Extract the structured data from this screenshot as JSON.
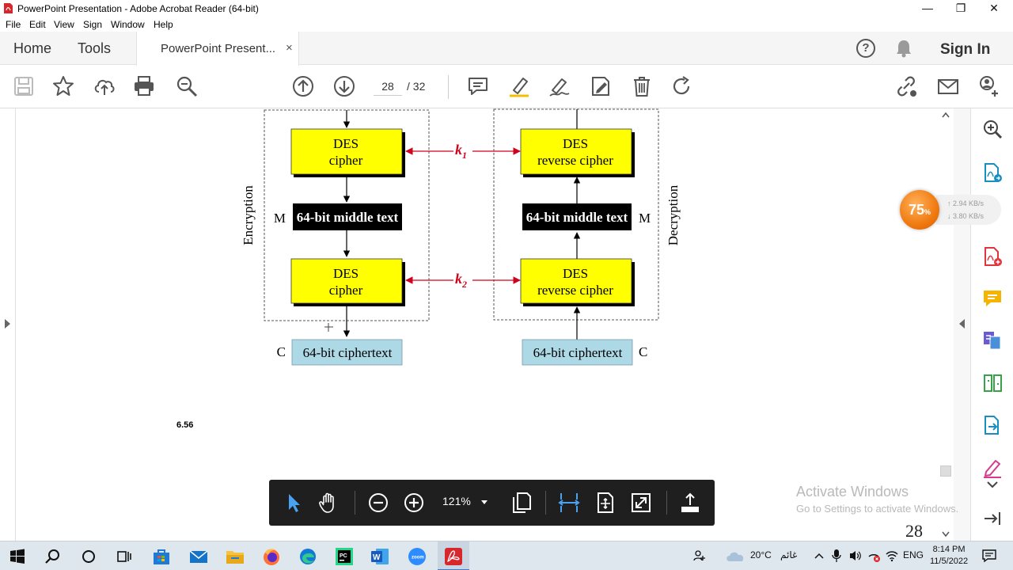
{
  "window": {
    "title": "PowerPoint Presentation - Adobe Acrobat Reader (64-bit)",
    "minimize": "—",
    "restore": "❐",
    "close": "✕"
  },
  "menu": [
    "File",
    "Edit",
    "View",
    "Sign",
    "Window",
    "Help"
  ],
  "tabs": {
    "home": "Home",
    "tools": "Tools",
    "document": "PowerPoint Present...",
    "close": "×"
  },
  "header": {
    "help": "?",
    "sign_in": "Sign In"
  },
  "toolbar": {
    "current_page": "28",
    "page_separator": "/  32"
  },
  "diagram": {
    "enc_label": "Encryption",
    "dec_label": "Decryption",
    "des_top": "DES",
    "cipher": "cipher",
    "reverse_cipher": "reverse cipher",
    "middle_text": "64-bit middle text",
    "ciphertext": "64-bit ciphertext",
    "m": "M",
    "c": "C",
    "k": "k",
    "k1_sub": "1",
    "k2_sub": "2",
    "slide_number": "6.56"
  },
  "speed_widget": {
    "percent": "75",
    "percent_sign": "%",
    "upload": "2.94 KB/s",
    "download": "3.80 KB/s"
  },
  "float_toolbar": {
    "zoom": "121%"
  },
  "watermark": {
    "line1": "Activate Windows",
    "line2": "Go to Settings to activate Windows."
  },
  "page_corner": "28",
  "taskbar": {
    "weather": "20°C",
    "weather_text": "غائم",
    "language": "ENG",
    "time": "8:14 PM",
    "date": "11/5/2022"
  },
  "colors": {
    "des_box": "#ffff00",
    "middle_box": "#000000",
    "cipher_box": "#add8e6",
    "key_arrow": "#d0021b",
    "adobe_red": "#d8262d"
  }
}
